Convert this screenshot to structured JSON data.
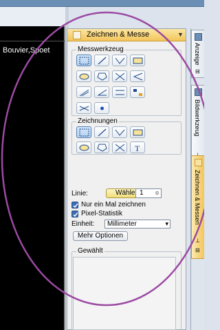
{
  "document_tab": {
    "title": "Bouvier,Spoet"
  },
  "panel": {
    "title": "Zeichnen & Messe",
    "measure_group": {
      "title": "Messwerkzeug"
    },
    "draw_group": {
      "title": "Zeichnungen"
    },
    "line_label": "Linie:",
    "choose_button": "Wählen",
    "line_width": "1",
    "checkbox_once": "Nur ein Mal zeichnen",
    "checkbox_pixel": "Pixel-Statistik",
    "unit_label": "Einheit:",
    "unit_value": "Millimeter",
    "more_button": "Mehr Optionen",
    "selected_group": {
      "title": "Gewählt"
    }
  },
  "sidebar": {
    "tabs": [
      {
        "label": "Anzeige"
      },
      {
        "label": "Bildwerkzeug"
      },
      {
        "label": "Zeichnen & Messen"
      }
    ]
  },
  "colors": {
    "accent": "#f3c55a",
    "selection_oval": "#9b4aa3",
    "checkbox": "#3a6db3"
  }
}
